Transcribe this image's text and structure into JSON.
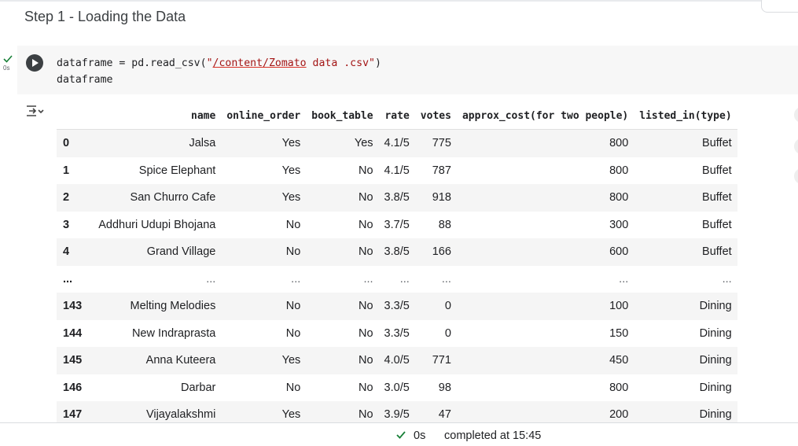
{
  "section": {
    "heading": "Step 1 - Loading the Data"
  },
  "cell": {
    "exec_time": "0s",
    "code_line1_prefix": "dataframe = pd.read_csv(",
    "code_line1_str_open": "\"",
    "code_line1_path": "/content/Zomato",
    "code_line1_str_rest": " data .csv\"",
    "code_line1_suffix": ")",
    "code_line2": "dataframe"
  },
  "table": {
    "columns": [
      "",
      "name",
      "online_order",
      "book_table",
      "rate",
      "votes",
      "approx_cost(for two people)",
      "listed_in(type)"
    ],
    "rows": [
      [
        "0",
        "Jalsa",
        "Yes",
        "Yes",
        "4.1/5",
        "775",
        "800",
        "Buffet"
      ],
      [
        "1",
        "Spice Elephant",
        "Yes",
        "No",
        "4.1/5",
        "787",
        "800",
        "Buffet"
      ],
      [
        "2",
        "San Churro Cafe",
        "Yes",
        "No",
        "3.8/5",
        "918",
        "800",
        "Buffet"
      ],
      [
        "3",
        "Addhuri Udupi Bhojana",
        "No",
        "No",
        "3.7/5",
        "88",
        "300",
        "Buffet"
      ],
      [
        "4",
        "Grand Village",
        "No",
        "No",
        "3.8/5",
        "166",
        "600",
        "Buffet"
      ],
      [
        "...",
        "...",
        "...",
        "...",
        "...",
        "...",
        "...",
        "..."
      ],
      [
        "143",
        "Melting Melodies",
        "No",
        "No",
        "3.3/5",
        "0",
        "100",
        "Dining"
      ],
      [
        "144",
        "New Indraprasta",
        "No",
        "No",
        "3.3/5",
        "0",
        "150",
        "Dining"
      ],
      [
        "145",
        "Anna Kuteera",
        "Yes",
        "No",
        "4.0/5",
        "771",
        "450",
        "Dining"
      ],
      [
        "146",
        "Darbar",
        "No",
        "No",
        "3.0/5",
        "98",
        "800",
        "Dining"
      ],
      [
        "147",
        "Vijayalakshmi",
        "Yes",
        "No",
        "3.9/5",
        "47",
        "200",
        "Dining"
      ]
    ]
  },
  "status": {
    "time": "0s",
    "text": "completed at 15:45"
  },
  "colors": {
    "success": "#188038",
    "row_stripe": "#f5f5f5",
    "string": "#a31515"
  },
  "icons": [
    "check-icon",
    "play-icon",
    "output-toggle-icon"
  ]
}
